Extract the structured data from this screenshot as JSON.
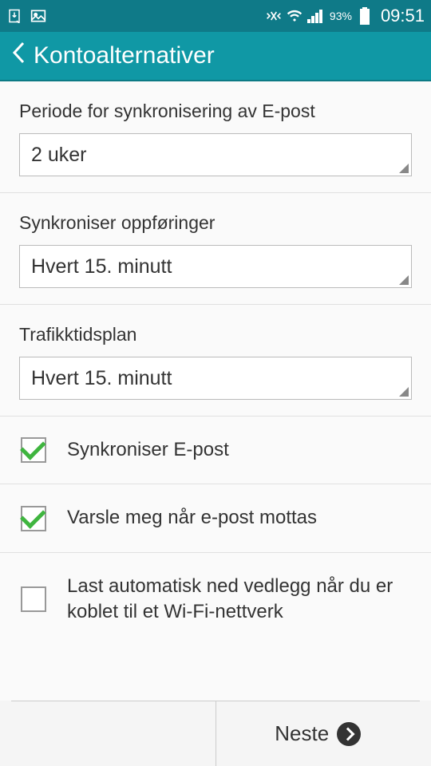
{
  "status_bar": {
    "battery_percent": "93%",
    "time": "09:51"
  },
  "app_bar": {
    "title": "Kontoalternativer"
  },
  "sections": {
    "sync_period": {
      "label": "Periode for synkronisering av E-post",
      "value": "2 uker"
    },
    "sync_entries": {
      "label": "Synkroniser oppføringer",
      "value": "Hvert 15. minutt"
    },
    "traffic_plan": {
      "label": "Trafikktidsplan",
      "value": "Hvert 15. minutt"
    }
  },
  "checkboxes": {
    "sync_email": {
      "label": "Synkroniser E-post",
      "checked": true
    },
    "notify_received": {
      "label": "Varsle meg når e-post mottas",
      "checked": true
    },
    "auto_download": {
      "label": "Last automatisk ned vedlegg når du er koblet til et Wi-Fi-nettverk",
      "checked": false
    }
  },
  "footer": {
    "next_label": "Neste"
  }
}
